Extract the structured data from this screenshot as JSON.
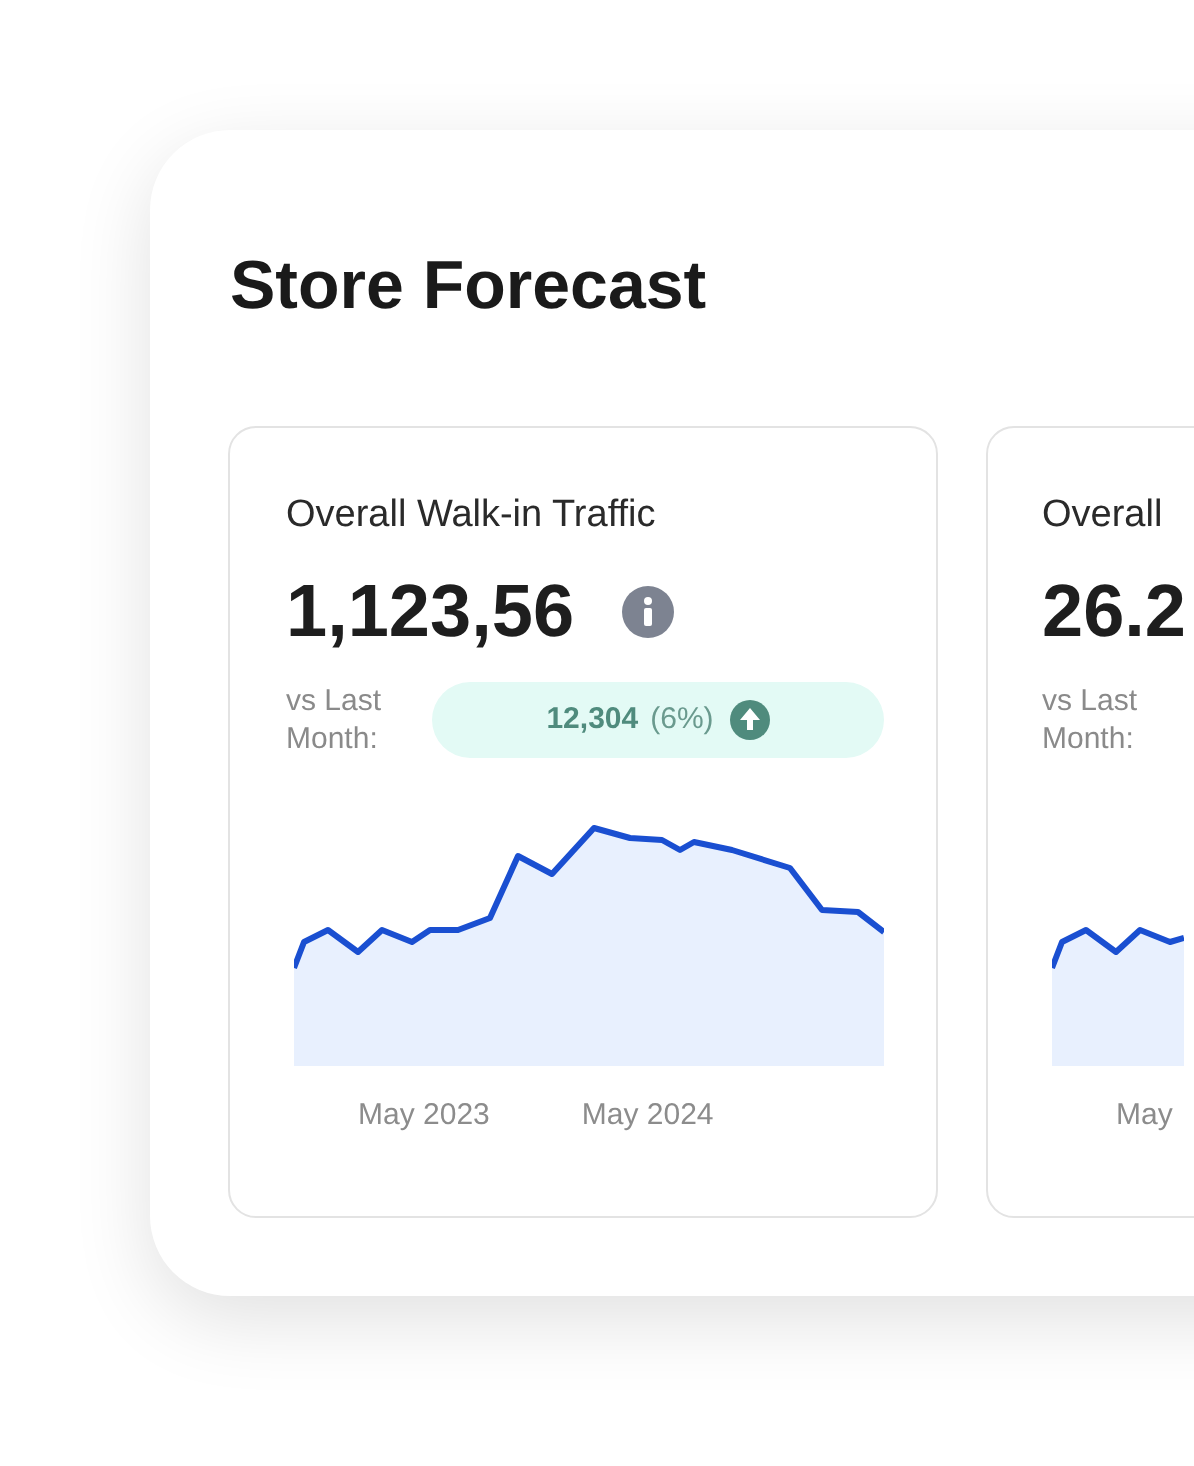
{
  "title": "Store Forecast",
  "cards": [
    {
      "title": "Overall Walk-in Traffic",
      "value": "1,123,56",
      "info_icon": true,
      "comparison_label": "vs Last Month:",
      "change": {
        "amount": "12,304",
        "percent": "(6%)"
      },
      "x_labels": [
        "May 2023",
        "May 2024"
      ]
    },
    {
      "title": "Overall",
      "value": "26.2",
      "comparison_label": "vs Last Month:",
      "x_labels": [
        "May"
      ]
    }
  ]
}
